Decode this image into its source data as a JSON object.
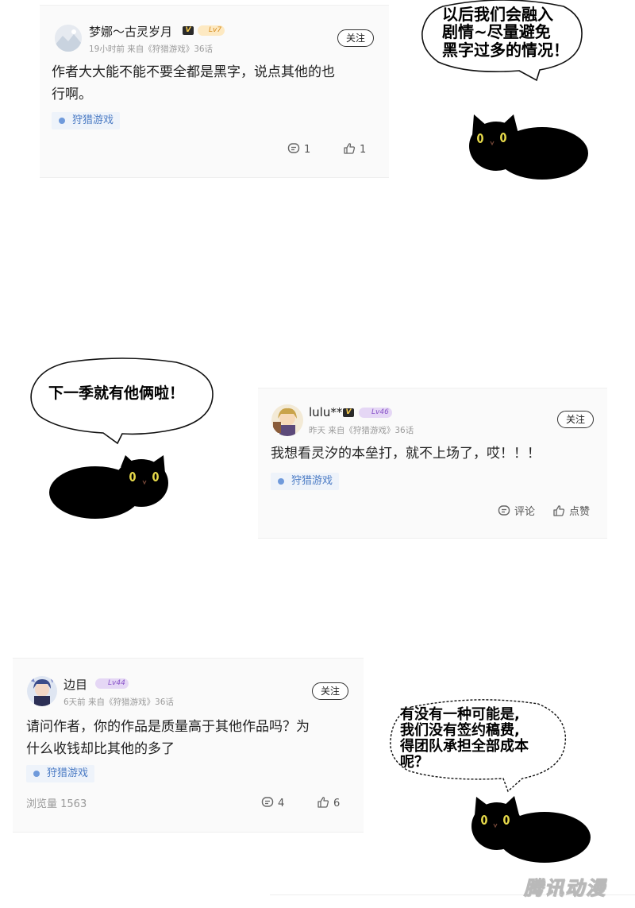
{
  "comments": [
    {
      "username": "梦娜～古灵岁月",
      "vip_badge": "V",
      "level": "Lv7",
      "meta": "19小时前 来自《狩猎游戏》36话",
      "follow_label": "关注",
      "text_lines": [
        "作者大大能不能不要全都是黑字，说点其他的也",
        "行啊。"
      ],
      "tag": "狩猎游戏",
      "reply_label": "1",
      "like_label": "1"
    },
    {
      "username": "lulu**",
      "vip_badge": "V",
      "level": "Lv46",
      "meta": "昨天 来自《狩猎游戏》36话",
      "follow_label": "关注",
      "text_lines": [
        "我想看灵汐的本垒打，就不上场了，哎！！！"
      ],
      "tag": "狩猎游戏",
      "reply_label": "评论",
      "like_label": "点赞"
    },
    {
      "username": "边目",
      "level": "Lv44",
      "meta": "6天前 来自《狩猎游戏》36话",
      "follow_label": "关注",
      "text_lines": [
        "请问作者，你的作品是质量高于其他作品吗？为",
        "什么收钱却比其他的多了"
      ],
      "tag": "狩猎游戏",
      "views": "浏览量 1563",
      "reply_label": "4",
      "like_label": "6"
    }
  ],
  "bubbles": [
    {
      "lines": [
        "以后我们会融入",
        "剧情~尽量避免",
        "黑字过多的情况！"
      ]
    },
    {
      "lines": [
        "下一季就有他俩啦！"
      ]
    },
    {
      "lines": [
        "有没有一种可能是,",
        "我们没有签约稿费,",
        "得团队承担全部成本",
        "呢？"
      ]
    }
  ],
  "watermark": "腾讯动漫",
  "colors": {
    "tag_text": "#4b7bc4",
    "tag_bg": "#eef3fa",
    "lv_gold": "#d58b1d",
    "lv_purple": "#8a55c9"
  }
}
